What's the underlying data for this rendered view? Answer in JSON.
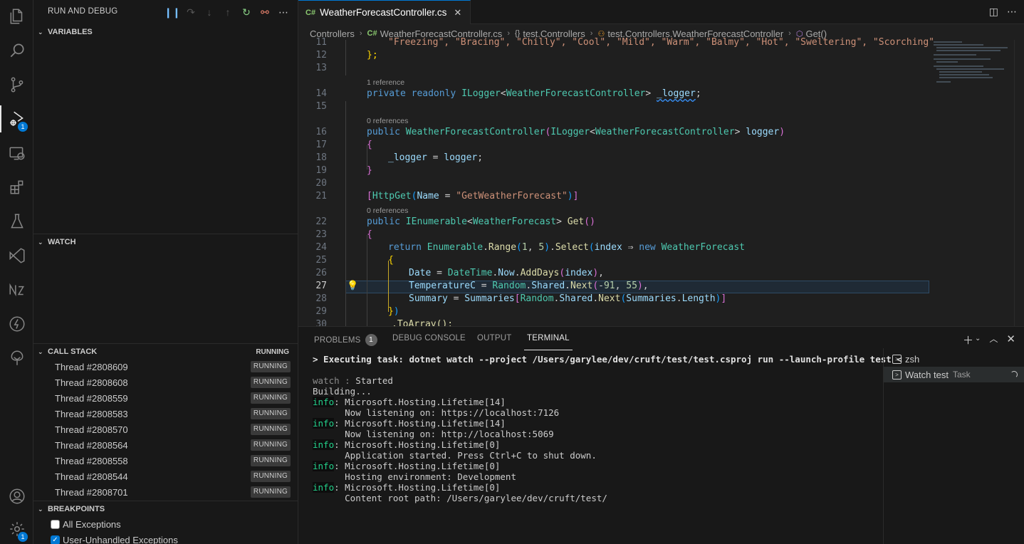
{
  "sidebar": {
    "title": "RUN AND DEBUG",
    "variables_title": "VARIABLES",
    "watch_title": "WATCH",
    "callstack_title": "CALL STACK",
    "callstack_state": "RUNNING",
    "threads": [
      {
        "name": "Thread #2808609",
        "state": "RUNNING"
      },
      {
        "name": "Thread #2808608",
        "state": "RUNNING"
      },
      {
        "name": "Thread #2808559",
        "state": "RUNNING"
      },
      {
        "name": "Thread #2808583",
        "state": "RUNNING"
      },
      {
        "name": "Thread #2808570",
        "state": "RUNNING"
      },
      {
        "name": "Thread #2808564",
        "state": "RUNNING"
      },
      {
        "name": "Thread #2808558",
        "state": "RUNNING"
      },
      {
        "name": "Thread #2808544",
        "state": "RUNNING"
      },
      {
        "name": "Thread #2808701",
        "state": "RUNNING"
      }
    ],
    "breakpoints_title": "BREAKPOINTS",
    "breakpoints": [
      {
        "label": "All Exceptions",
        "checked": false
      },
      {
        "label": "User-Unhandled Exceptions",
        "checked": true
      }
    ]
  },
  "activity": {
    "debug_badge": "1",
    "settings_badge": "1"
  },
  "editor": {
    "tab_lang": "C#",
    "tab_title": "WeatherForecastController.cs",
    "breadcrumbs": [
      "Controllers",
      "WeatherForecastController.cs",
      "test.Controllers",
      "test.Controllers.WeatherForecastController",
      "Get()"
    ],
    "lens_1ref": "1 reference",
    "lens_0ref": "0 references",
    "lines": {
      "l11": "\"Freezing\", \"Bracing\", \"Chilly\", \"Cool\", \"Mild\", \"Warm\", \"Balmy\", \"Hot\", \"Sweltering\", \"Scorching\"",
      "l12": "};",
      "l14": "private readonly ILogger<WeatherForecastController> _logger;",
      "l16": "public WeatherForecastController(ILogger<WeatherForecastController> logger)",
      "l17": "{",
      "l18": "_logger = logger;",
      "l19": "}",
      "l21": "[HttpGet(Name = \"GetWeatherForecast\")]",
      "l22": "public IEnumerable<WeatherForecast> Get()",
      "l23": "{",
      "l24": "return Enumerable.Range(1, 5).Select(index => new WeatherForecast",
      "l25": "{",
      "l26": "Date = DateTime.Now.AddDays(index),",
      "l27": "TemperatureC = Random.Shared.Next(-91, 55),",
      "l28": "Summary = Summaries[Random.Shared.Next(Summaries.Length)]",
      "l29": "})",
      "l30": ".ToArray();"
    },
    "line_numbers": [
      "11",
      "12",
      "13",
      "14",
      "15",
      "16",
      "17",
      "18",
      "19",
      "20",
      "21",
      "22",
      "23",
      "24",
      "25",
      "26",
      "27",
      "28",
      "29",
      "30"
    ]
  },
  "panel": {
    "tabs": [
      "PROBLEMS",
      "DEBUG CONSOLE",
      "OUTPUT",
      "TERMINAL"
    ],
    "problems_count": "1",
    "terminal_lines": [
      "> Executing task: dotnet watch --project /Users/garylee/dev/cruft/test/test.csproj run --launch-profile test <",
      "",
      "watch : Started",
      "Building...",
      "info: Microsoft.Hosting.Lifetime[14]",
      "      Now listening on: https://localhost:7126",
      "info: Microsoft.Hosting.Lifetime[14]",
      "      Now listening on: http://localhost:5069",
      "info: Microsoft.Hosting.Lifetime[0]",
      "      Application started. Press Ctrl+C to shut down.",
      "info: Microsoft.Hosting.Lifetime[0]",
      "      Hosting environment: Development",
      "info: Microsoft.Hosting.Lifetime[0]",
      "      Content root path: /Users/garylee/dev/cruft/test/"
    ],
    "terminals": [
      {
        "name": "zsh",
        "sub": ""
      },
      {
        "name": "Watch test",
        "sub": "Task"
      }
    ]
  }
}
